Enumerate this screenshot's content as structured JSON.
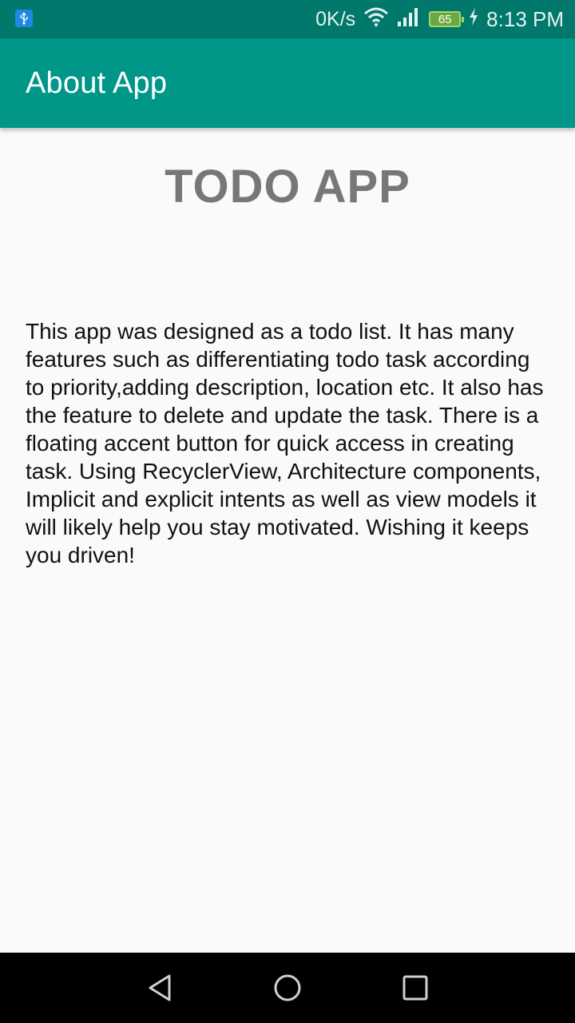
{
  "status_bar": {
    "net_speed": "0K/s",
    "battery_level": "65",
    "time": "8:13 PM",
    "icons": [
      "usb-icon",
      "wifi-icon",
      "signal-icon",
      "battery-icon",
      "charging-icon"
    ]
  },
  "app_bar": {
    "title": "About App",
    "color": "#009788"
  },
  "content": {
    "heading": "TODO APP",
    "body": "This app was designed as a todo list. It has many features such as differentiating todo task according to priority,adding description, location etc. It also has the feature to delete and update the task. There is a floating accent button for quick access in creating task. Using RecyclerView, Architecture components, Implicit and explicit intents as well as view models it will likely help you stay motivated. Wishing it keeps you driven!"
  },
  "nav_bar": {
    "buttons": [
      "back-icon",
      "home-icon",
      "recents-icon"
    ]
  }
}
